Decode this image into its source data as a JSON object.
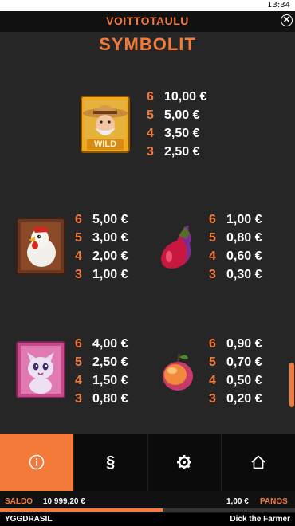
{
  "status_bar": {
    "time": "13:34"
  },
  "header": {
    "title": "VOITTOTAULU",
    "close_icon": "close-icon"
  },
  "section": {
    "title": "SYMBOLIT"
  },
  "symbols": [
    {
      "name": "farmer",
      "wild_label": "WILD",
      "pays": [
        {
          "count": "6",
          "amount": "10,00 €"
        },
        {
          "count": "5",
          "amount": "5,00 €"
        },
        {
          "count": "4",
          "amount": "3,50 €"
        },
        {
          "count": "3",
          "amount": "2,50 €"
        }
      ]
    },
    {
      "name": "rooster",
      "pays": [
        {
          "count": "6",
          "amount": "5,00 €"
        },
        {
          "count": "5",
          "amount": "3,00 €"
        },
        {
          "count": "4",
          "amount": "2,00 €"
        },
        {
          "count": "3",
          "amount": "1,00 €"
        }
      ]
    },
    {
      "name": "eggplant",
      "pays": [
        {
          "count": "6",
          "amount": "1,00 €"
        },
        {
          "count": "5",
          "amount": "0,80 €"
        },
        {
          "count": "4",
          "amount": "0,60 €"
        },
        {
          "count": "3",
          "amount": "0,30 €"
        }
      ]
    },
    {
      "name": "cat",
      "pays": [
        {
          "count": "6",
          "amount": "4,00 €"
        },
        {
          "count": "5",
          "amount": "2,50 €"
        },
        {
          "count": "4",
          "amount": "1,50 €"
        },
        {
          "count": "3",
          "amount": "0,80 €"
        }
      ]
    },
    {
      "name": "peach",
      "pays": [
        {
          "count": "6",
          "amount": "0,90 €"
        },
        {
          "count": "5",
          "amount": "0,70 €"
        },
        {
          "count": "4",
          "amount": "0,50 €"
        },
        {
          "count": "3",
          "amount": "0,20 €"
        }
      ]
    }
  ],
  "nav": [
    {
      "icon": "info-icon",
      "active": true
    },
    {
      "icon": "paragraph-icon",
      "label": "§"
    },
    {
      "icon": "gear-icon"
    },
    {
      "icon": "home-icon"
    }
  ],
  "info_bar": {
    "balance_label": "SALDO",
    "balance_value": "10 999,20 €",
    "bet_value": "1,00 €",
    "bet_label": "PANOS",
    "progress": 0.55
  },
  "footer": {
    "brand": "YGGDRASIL",
    "game_name": "Dick the Farmer"
  },
  "colors": {
    "accent": "#f47a3a",
    "panel": "#262626",
    "nav_bg": "#0b0b0b"
  }
}
